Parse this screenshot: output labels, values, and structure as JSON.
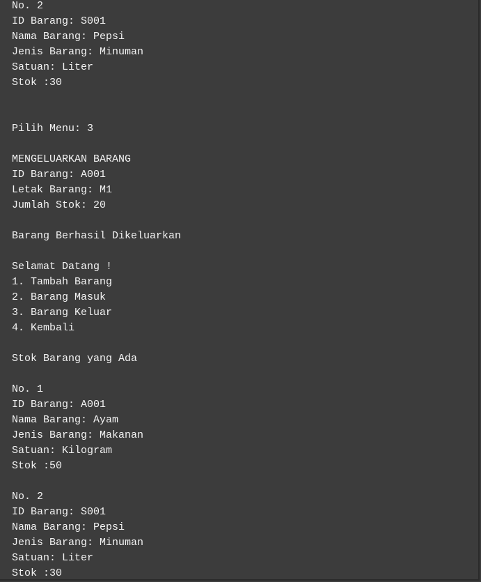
{
  "console": {
    "lines": [
      "No. 2",
      "ID Barang: S001",
      "Nama Barang: Pepsi",
      "Jenis Barang: Minuman",
      "Satuan: Liter",
      "Stok :30",
      "",
      "",
      "Pilih Menu: 3",
      "",
      "MENGELUARKAN BARANG",
      "ID Barang: A001",
      "Letak Barang: M1",
      "Jumlah Stok: 20",
      "",
      "Barang Berhasil Dikeluarkan",
      "",
      "Selamat Datang !",
      "1. Tambah Barang",
      "2. Barang Masuk",
      "3. Barang Keluar",
      "4. Kembali",
      "",
      "Stok Barang yang Ada",
      "",
      "No. 1",
      "ID Barang: A001",
      "Nama Barang: Ayam",
      "Jenis Barang: Makanan",
      "Satuan: Kilogram",
      "Stok :50",
      "",
      "No. 2",
      "ID Barang: S001",
      "Nama Barang: Pepsi",
      "Jenis Barang: Minuman",
      "Satuan: Liter",
      "Stok :30"
    ]
  },
  "colors": {
    "background": "#3c3c3c",
    "text": "#f2f2f2"
  }
}
